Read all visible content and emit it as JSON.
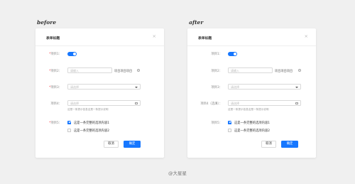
{
  "captions": {
    "before": "before",
    "after": "after"
  },
  "modal": {
    "title": "表单标题",
    "close": "×"
  },
  "before": {
    "fields": [
      {
        "required": "*",
        "label": "项目1："
      },
      {
        "required": "*",
        "label": "项目2："
      },
      {
        "required": "*",
        "label": "项目3："
      },
      {
        "required": "",
        "label": "项目4："
      },
      {
        "required": "*",
        "label": "项目5："
      }
    ]
  },
  "after": {
    "fields": [
      {
        "required": "",
        "label": "项目1："
      },
      {
        "required": "",
        "label": "项目2："
      },
      {
        "required": "",
        "label": "项目3："
      },
      {
        "required": "",
        "label": "项目4（选填）："
      },
      {
        "required": "",
        "label": "项目5："
      }
    ]
  },
  "form": {
    "toggle_on": true,
    "input_placeholder": "请输入",
    "input_suffix": "项目项目项目",
    "info_icon": "info-circle-icon",
    "select_placeholder": "请选择",
    "date_placeholder": "请选择",
    "date_help": "这是一条提示信息这是一条提示说明",
    "options": [
      {
        "label": "这是一条完整的选项内容1",
        "checked": true
      },
      {
        "label": "这是一条完整的选项内容2",
        "checked": false
      }
    ],
    "cancel_label": "取消",
    "ok_label": "确定"
  },
  "colors": {
    "primary": "#1677ff",
    "required": "#f5222d"
  },
  "watermark": "@大星星"
}
